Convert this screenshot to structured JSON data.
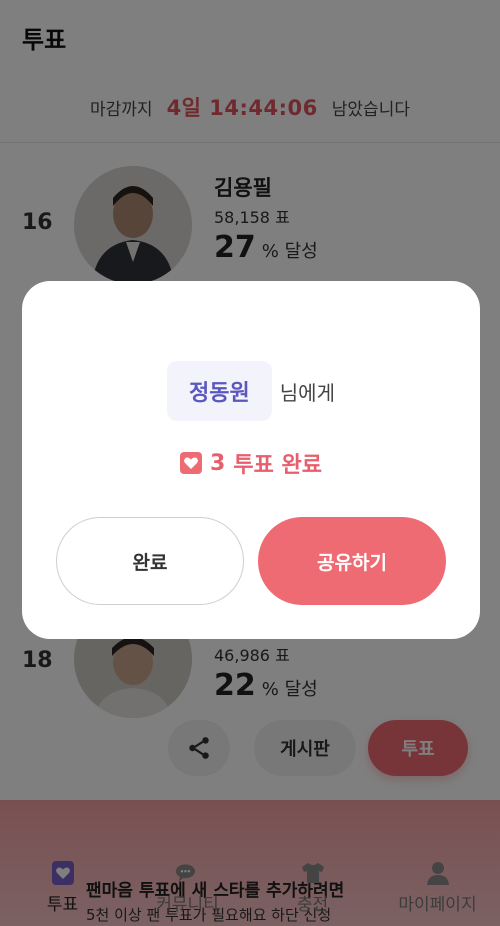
{
  "header": {
    "title": "투표"
  },
  "deadline": {
    "prefix": "마감까지",
    "time": "4일 14:44:06",
    "suffix": "남았습니다"
  },
  "candidates": [
    {
      "rank": "16",
      "name": "김용필",
      "votes": "58,158 표",
      "percent": "27",
      "percent_unit": "% 달성"
    },
    {
      "rank": "18",
      "votes": "46,986 표",
      "percent": "22",
      "percent_unit": "% 달성"
    }
  ],
  "actions": {
    "board_label": "게시판",
    "vote_label": "투표",
    "share_icon": "share-icon"
  },
  "promo": {
    "line1": "팬마음 투표에 새 스타를 추가하려면",
    "line2": "5천 이상 팬 투표가 필요해요 하단 신청"
  },
  "tabs": [
    {
      "label": "투표",
      "icon": "heart-card-icon",
      "active": true
    },
    {
      "label": "커뮤니티",
      "icon": "chat-bubbles-icon",
      "active": false
    },
    {
      "label": "충전",
      "icon": "shirt-icon",
      "active": false
    },
    {
      "label": "마이페이지",
      "icon": "person-icon",
      "active": false
    }
  ],
  "modal": {
    "recipient": "정동원",
    "recipient_suffix": "님에게",
    "vote_count": "3",
    "vote_complete_text": "투표 완료",
    "done_label": "완료",
    "share_label": "공유하기"
  },
  "colors": {
    "accent": "#ef6b73",
    "countdown": "#e0545f",
    "recipient": "#5a58bd"
  }
}
